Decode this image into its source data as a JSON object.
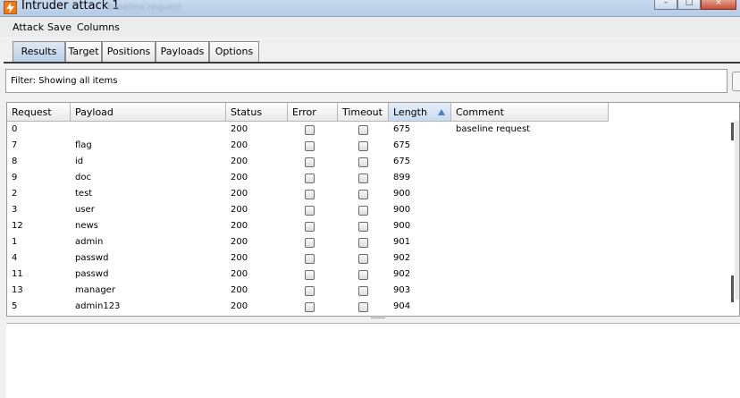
{
  "window": {
    "title": "Intruder attack 1",
    "blurred_title": "baseline request"
  },
  "menu": [
    "Attack",
    "Save",
    "Columns"
  ],
  "tabs": [
    {
      "label": "Results",
      "active": true
    },
    {
      "label": "Target",
      "active": false
    },
    {
      "label": "Positions",
      "active": false
    },
    {
      "label": "Payloads",
      "active": false
    },
    {
      "label": "Options",
      "active": false
    }
  ],
  "filter": {
    "text": "Filter:  Showing all items"
  },
  "table": {
    "columns": [
      "Request",
      "Payload",
      "Status",
      "Error",
      "Timeout",
      "Length",
      "Comment"
    ],
    "sorted_column": "Length",
    "rows": [
      {
        "request": "0",
        "payload": "",
        "status": "200",
        "error": false,
        "timeout": false,
        "length": "675",
        "comment": "baseline request"
      },
      {
        "request": "7",
        "payload": "flag",
        "status": "200",
        "error": false,
        "timeout": false,
        "length": "675",
        "comment": ""
      },
      {
        "request": "8",
        "payload": "id",
        "status": "200",
        "error": false,
        "timeout": false,
        "length": "675",
        "comment": ""
      },
      {
        "request": "9",
        "payload": "doc",
        "status": "200",
        "error": false,
        "timeout": false,
        "length": "899",
        "comment": ""
      },
      {
        "request": "2",
        "payload": "test",
        "status": "200",
        "error": false,
        "timeout": false,
        "length": "900",
        "comment": ""
      },
      {
        "request": "3",
        "payload": "user",
        "status": "200",
        "error": false,
        "timeout": false,
        "length": "900",
        "comment": ""
      },
      {
        "request": "12",
        "payload": "news",
        "status": "200",
        "error": false,
        "timeout": false,
        "length": "900",
        "comment": ""
      },
      {
        "request": "1",
        "payload": "admin",
        "status": "200",
        "error": false,
        "timeout": false,
        "length": "901",
        "comment": ""
      },
      {
        "request": "4",
        "payload": "passwd",
        "status": "200",
        "error": false,
        "timeout": false,
        "length": "902",
        "comment": ""
      },
      {
        "request": "11",
        "payload": "passwd",
        "status": "200",
        "error": false,
        "timeout": false,
        "length": "902",
        "comment": ""
      },
      {
        "request": "13",
        "payload": "manager",
        "status": "200",
        "error": false,
        "timeout": false,
        "length": "903",
        "comment": ""
      },
      {
        "request": "5",
        "payload": "admin123",
        "status": "200",
        "error": false,
        "timeout": false,
        "length": "904",
        "comment": ""
      }
    ]
  },
  "colors": {
    "accent": "#4b7fbf",
    "app_icon": "#f07a18"
  }
}
